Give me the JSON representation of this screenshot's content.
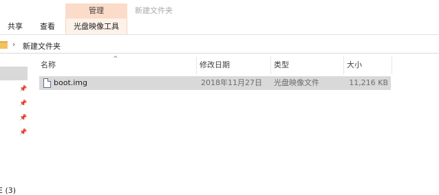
{
  "window": {
    "title": "新建文件夹"
  },
  "ribbon": {
    "context_group": "管理",
    "tabs": [
      {
        "label": "共享"
      },
      {
        "label": "查看"
      },
      {
        "label": "光盘映像工具"
      }
    ]
  },
  "address": {
    "separator": "›",
    "crumbs": [
      "新建文件夹"
    ]
  },
  "nav": {
    "pins": [
      "📌",
      "📌",
      "📌",
      "📌"
    ],
    "count_label": "E (3)"
  },
  "columns": {
    "name": "名称",
    "date": "修改日期",
    "type": "类型",
    "size": "大小"
  },
  "sort_indicator": "^",
  "files": [
    {
      "name": "boot.img",
      "date": "2018年11月27日",
      "type": "光盘映像文件",
      "size": "11,216 KB",
      "icon": "disc-image-file-icon"
    }
  ],
  "colors": {
    "context_tab": "#fbdcc8",
    "selection": "#d9d9d9"
  }
}
